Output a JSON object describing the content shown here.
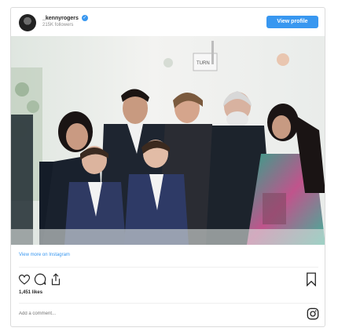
{
  "post": {
    "username": "_kennyrogers",
    "followers": "215K followers",
    "view_profile_label": "View profile",
    "view_more_label": "View more on Instagram",
    "likes": "1,451 likes",
    "comment_placeholder": "Add a comment...",
    "photo_sign_text": "TURN"
  },
  "icons": {
    "verified": "verified-badge-icon",
    "like": "heart-icon",
    "comment": "comment-icon",
    "share": "share-icon",
    "save": "bookmark-icon",
    "instagram": "instagram-logo-icon"
  },
  "colors": {
    "accent": "#3897f0",
    "text": "#262626",
    "muted": "#8e8e8e",
    "border": "#dbdbdb"
  }
}
